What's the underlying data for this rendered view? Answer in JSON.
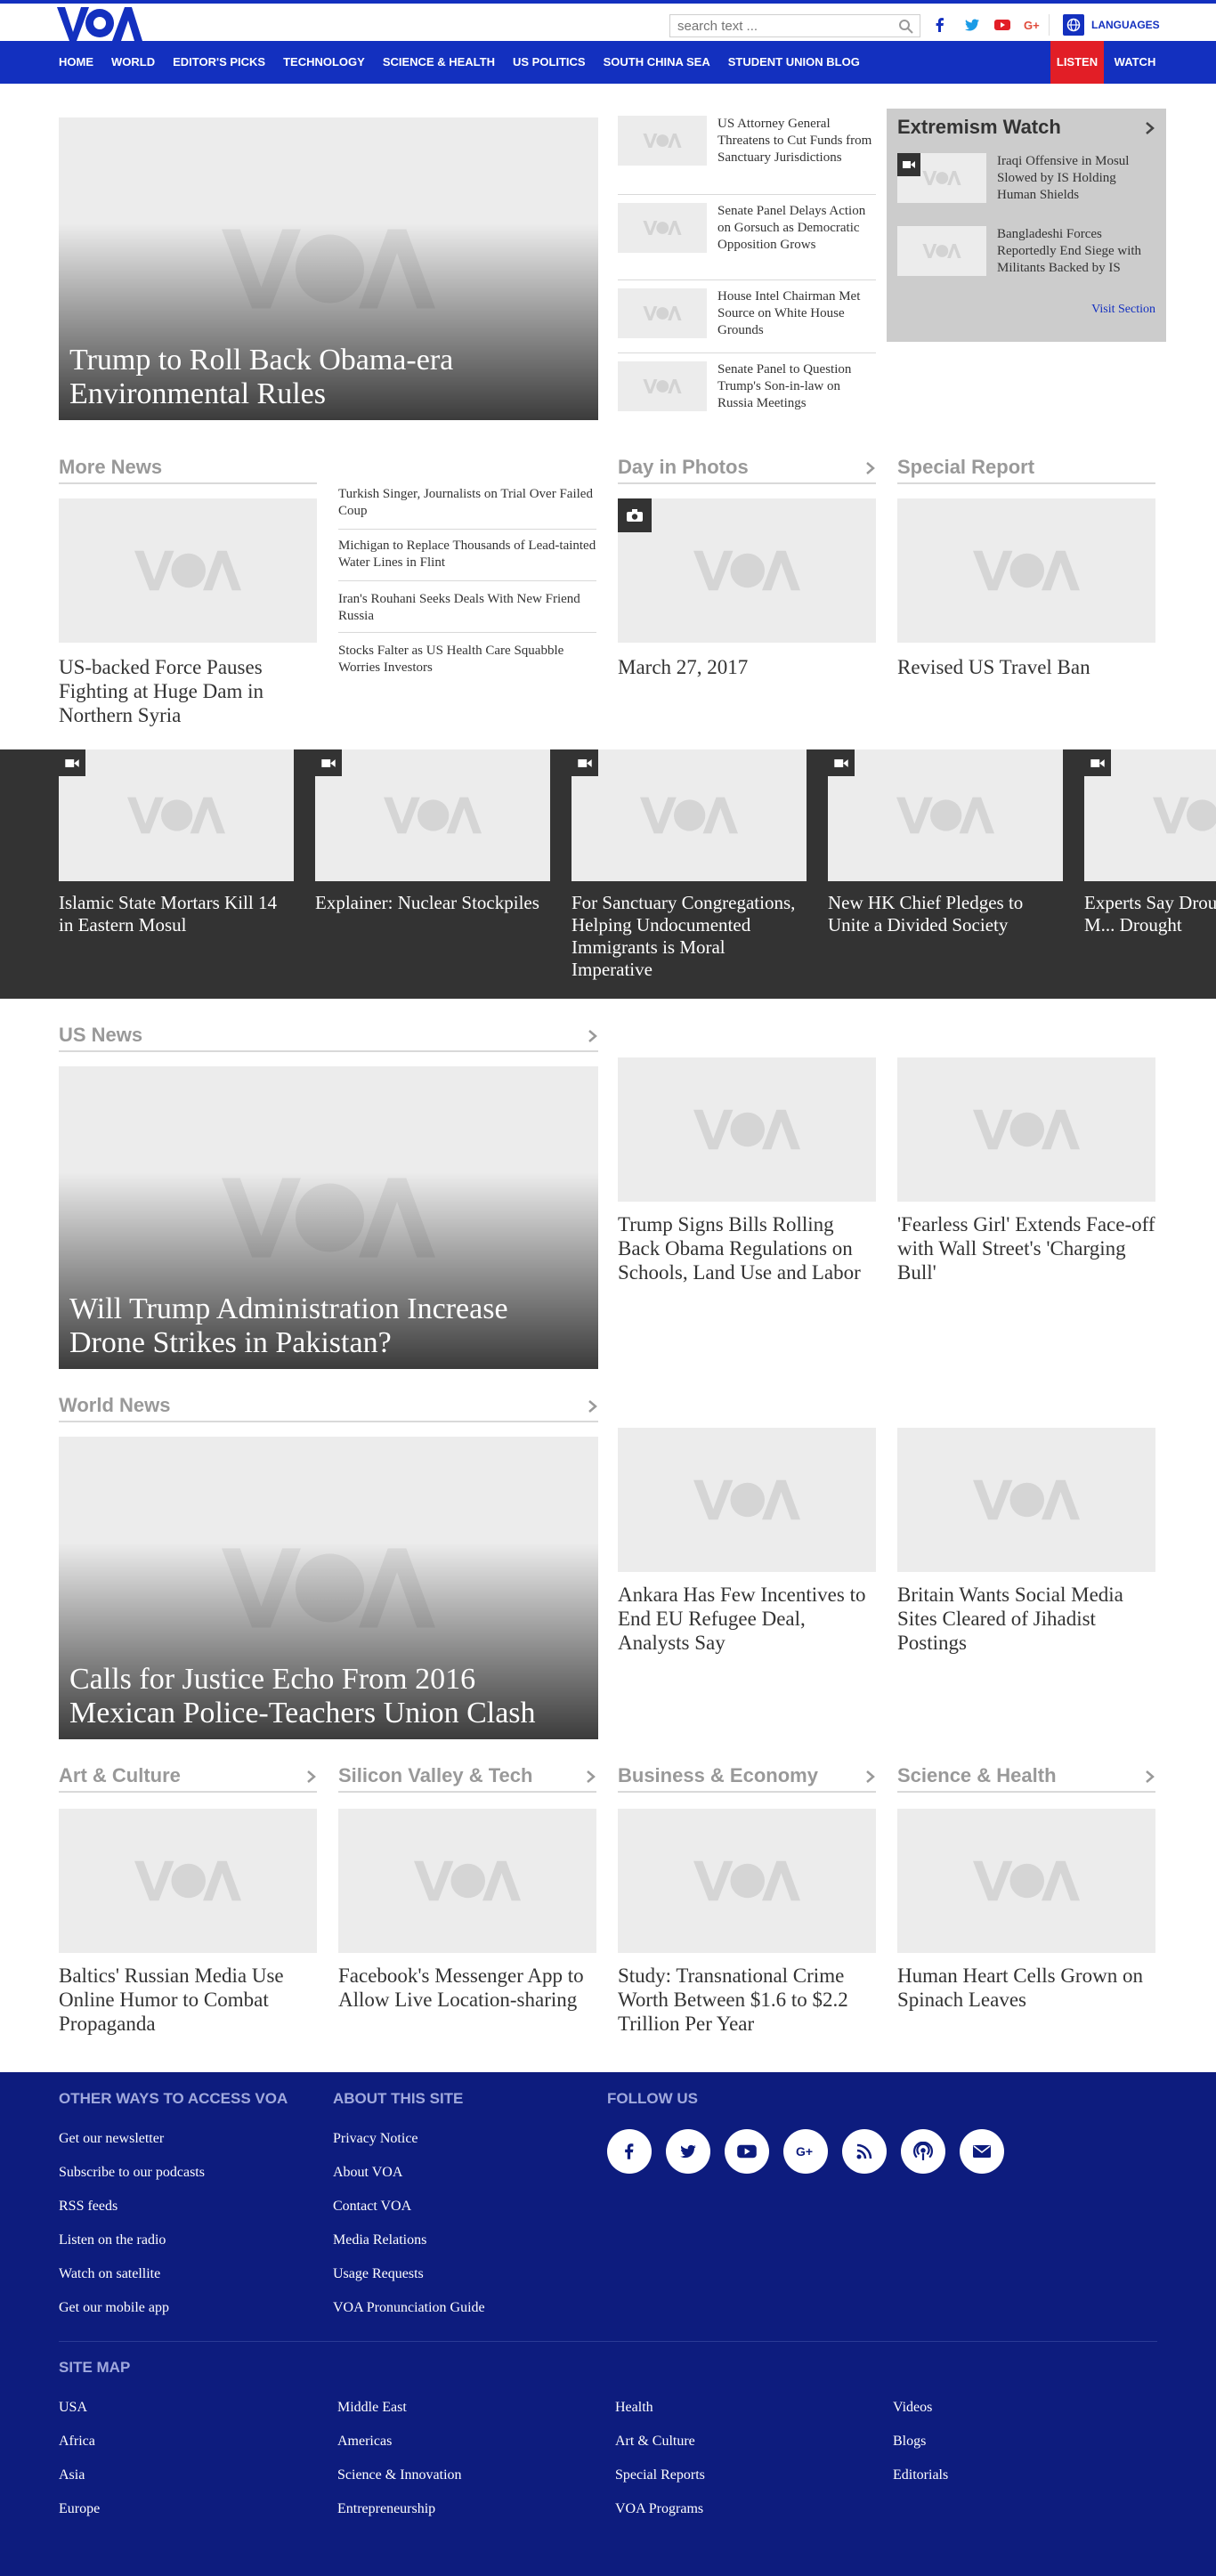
{
  "header": {
    "search_placeholder": "search text ...",
    "languages_label": "LANGUAGES",
    "social": [
      "facebook-icon",
      "twitter-icon",
      "youtube-icon",
      "google-plus-icon"
    ],
    "brand_color": "#1330bf"
  },
  "nav": {
    "items": [
      "HOME",
      "WORLD",
      "EDITOR'S PICKS",
      "TECHNOLOGY",
      "SCIENCE & HEALTH",
      "US POLITICS",
      "SOUTH CHINA SEA",
      "STUDENT UNION BLOG"
    ],
    "listen": "LISTEN",
    "watch": "WATCH"
  },
  "top": {
    "hero": "Trump to Roll Back Obama-era Environmental Rules",
    "side": [
      "US Attorney General Threatens to Cut Funds from Sanctuary Jurisdictions",
      "Senate Panel Delays Action on Gorsuch as Democratic Opposition Grows",
      "House Intel Chairman Met Source on White House Grounds",
      "Senate Panel to Question Trump's Son-in-law on Russia Meetings"
    ],
    "extremism": {
      "title": "Extremism Watch",
      "items": [
        "Iraqi Offensive in Mosul Slowed by IS Holding Human Shields",
        "Bangladeshi Forces Reportedly End Siege with Militants Backed by IS"
      ],
      "visit": "Visit Section"
    }
  },
  "more_news": {
    "title": "More News",
    "main": "US-backed Force Pauses Fighting at Huge Dam in Northern Syria",
    "links": [
      "Turkish Singer, Journalists on Trial Over Failed Coup",
      "Michigan to Replace Thousands of Lead-tainted Water Lines in Flint",
      "Iran's Rouhani Seeks Deals With New Friend Russia",
      "Stocks Falter as US Health Care Squabble Worries Investors"
    ]
  },
  "day_in_photos": {
    "title": "Day in Photos",
    "caption": "March 27, 2017"
  },
  "special_report": {
    "title": "Special Report",
    "caption": "Revised US Travel Ban"
  },
  "video_strip": [
    "Islamic State Mortars Kill 14 in Eastern Mosul",
    "Explainer: Nuclear Stockpiles",
    "For Sanctuary Congregations, Helping Undocumented Immigrants is Moral Imperative",
    "New HK Chief Pledges to Unite a Divided Society",
    "Experts Say Drought May Be M... Drought"
  ],
  "us_news": {
    "title": "US News",
    "hero": "Will Trump Administration Increase Drone Strikes in Pakistan?",
    "cards": [
      "Trump Signs Bills Rolling Back Obama Regulations on Schools, Land Use and Labor",
      "'Fearless Girl' Extends Face-off with Wall Street's 'Charging Bull'"
    ]
  },
  "world_news": {
    "title": "World News",
    "hero": "Calls for Justice Echo From 2016 Mexican Police-Teachers Union Clash",
    "cards": [
      "Ankara Has Few Incentives to End EU Refugee Deal, Analysts Say",
      "Britain Wants Social Media Sites Cleared of Jihadist Postings"
    ]
  },
  "categories": [
    {
      "title": "Art & Culture",
      "story": "Baltics' Russian Media Use Online Humor to Combat Propaganda"
    },
    {
      "title": "Silicon Valley & Tech",
      "story": "Facebook's Messenger App to Allow Live Location-sharing"
    },
    {
      "title": "Business & Economy",
      "story": "Study: Transnational Crime Worth Between $1.6 to $2.2 Trillion Per Year"
    },
    {
      "title": "Science & Health",
      "story": "Human Heart Cells Grown on Spinach Leaves"
    }
  ],
  "footer": {
    "ways_title": "OTHER WAYS TO ACCESS VOA",
    "ways": [
      "Get our newsletter",
      "Subscribe to our podcasts",
      "RSS feeds",
      "Listen on the radio",
      "Watch on satellite",
      "Get our mobile app"
    ],
    "about_title": "ABOUT THIS SITE",
    "about": [
      "Privacy Notice",
      "About VOA",
      "Contact VOA",
      "Media Relations",
      "Usage Requests",
      "VOA Pronunciation Guide"
    ],
    "follow_title": "FOLLOW US",
    "follow_icons": [
      "facebook-icon",
      "twitter-icon",
      "youtube-icon",
      "google-plus-icon",
      "rss-icon",
      "podcast-icon",
      "email-icon"
    ],
    "sitemap_title": "SITE MAP",
    "sitemap": [
      [
        "USA",
        "Africa",
        "Asia",
        "Europe"
      ],
      [
        "Middle East",
        "Americas",
        "Science & Innovation",
        "Entrepreneurship"
      ],
      [
        "Health",
        "Art & Culture",
        "Special Reports",
        "VOA Programs"
      ],
      [
        "Videos",
        "Blogs",
        "Editorials"
      ]
    ],
    "bg_color": "#0d1c7e"
  }
}
